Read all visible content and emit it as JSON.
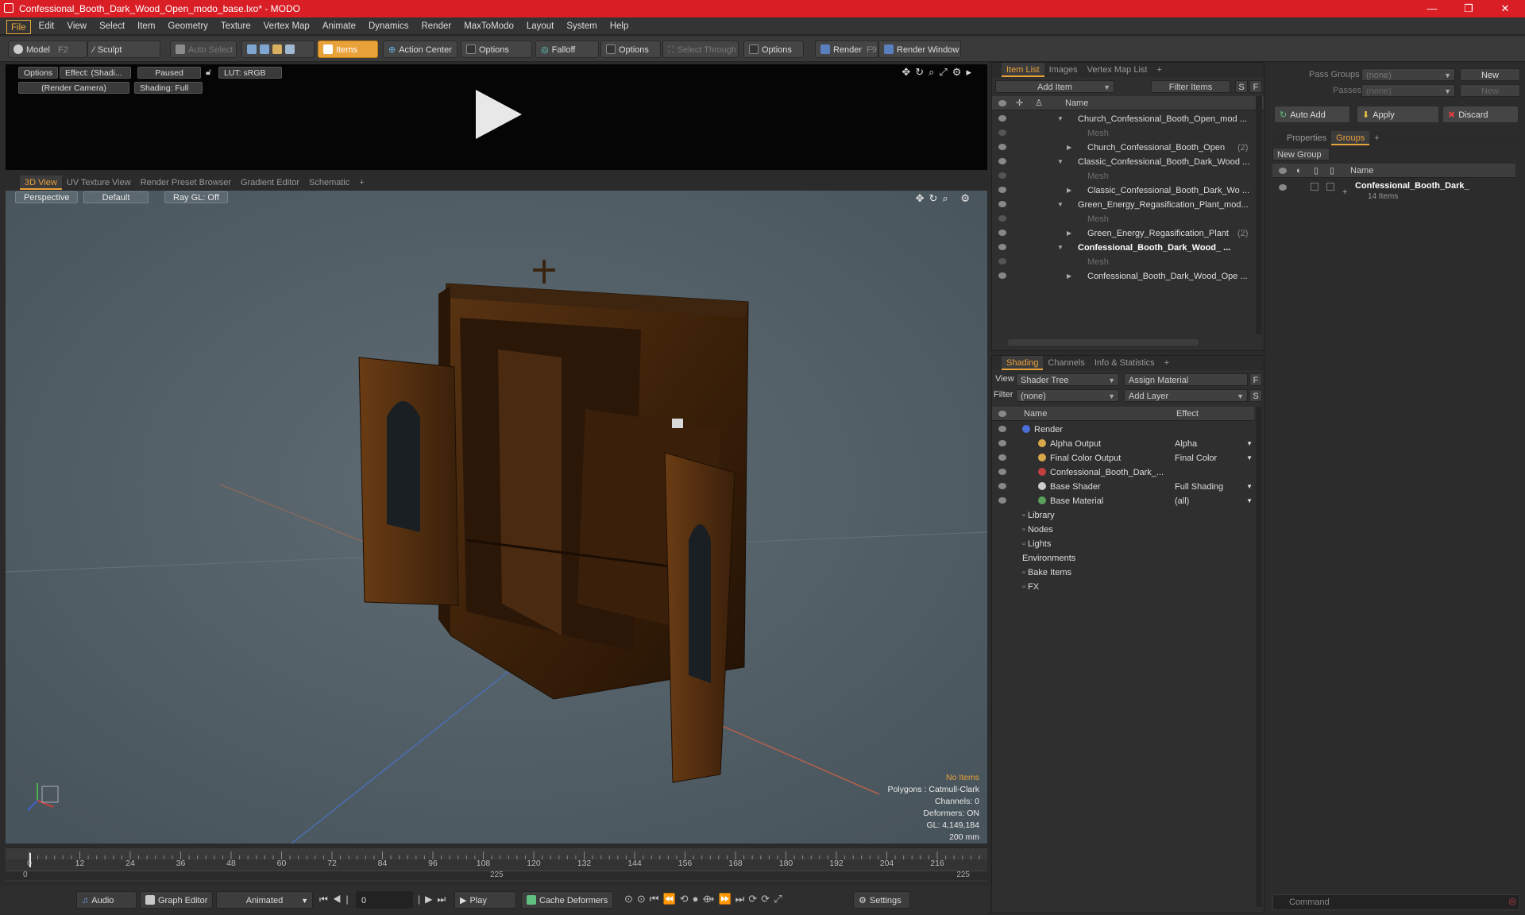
{
  "window": {
    "title": "Confessional_Booth_Dark_Wood_Open_modo_base.lxo* - MODO",
    "minimize": "—",
    "maximize": "❐",
    "close": "✕"
  },
  "menu": [
    "File",
    "Edit",
    "View",
    "Select",
    "Item",
    "Geometry",
    "Texture",
    "Vertex Map",
    "Animate",
    "Dynamics",
    "Render",
    "MaxToModo",
    "Layout",
    "System",
    "Help"
  ],
  "toolbar": {
    "model": "Model",
    "model_key": "F2",
    "sculpt": "Sculpt",
    "auto_select": "Auto Select",
    "items": "Items",
    "action_center": "Action Center",
    "options1": "Options",
    "falloff": "Falloff",
    "options2": "Options",
    "select_through": "Select Through",
    "options3": "Options",
    "render": "Render",
    "render_key": "F9",
    "render_window": "Render Window"
  },
  "preview": {
    "options": "Options",
    "effect": "Effect: (Shadi...",
    "paused": "Paused",
    "lut": "LUT: sRGB",
    "camera": "(Render Camera)",
    "shading": "Shading: Full"
  },
  "viewport_tabs": [
    "3D View",
    "UV Texture View",
    "Render Preset Browser",
    "Gradient Editor",
    "Schematic"
  ],
  "viewport": {
    "perspective": "Perspective",
    "default": "Default",
    "raygl": "Ray GL: Off",
    "stats": [
      "No Items",
      "Polygons : Catmull-Clark",
      "Channels: 0",
      "Deformers: ON",
      "GL: 4,149,184",
      "200 mm"
    ]
  },
  "timeline": {
    "ticks": [
      "0",
      "12",
      "24",
      "36",
      "48",
      "60",
      "72",
      "84",
      "96",
      "108",
      "120",
      "132",
      "144",
      "156",
      "168",
      "180",
      "192",
      "204",
      "216"
    ],
    "start": "0",
    "mid": "225",
    "end": "225"
  },
  "bottom": {
    "audio": "Audio",
    "graph_editor": "Graph Editor",
    "animated": "Animated",
    "frame": "0",
    "play": "Play",
    "cache_deformers": "Cache Deformers",
    "settings": "Settings"
  },
  "itemlist": {
    "tabs": [
      "Item List",
      "Images",
      "Vertex Map List"
    ],
    "add_item": "Add Item",
    "filter_items": "Filter Items",
    "s": "S",
    "f": "F",
    "col_name": "Name",
    "rows": [
      {
        "text": "Church_Confessional_Booth_Open_mod ...",
        "cls": "",
        "indent": 0
      },
      {
        "text": "Mesh",
        "cls": "mesh",
        "indent": 1
      },
      {
        "text": "Church_Confessional_Booth_Open",
        "count": "(2)",
        "cls": "",
        "indent": 1
      },
      {
        "text": "Classic_Confessional_Booth_Dark_Wood ...",
        "cls": "",
        "indent": 0
      },
      {
        "text": "Mesh",
        "cls": "mesh",
        "indent": 1
      },
      {
        "text": "Classic_Confessional_Booth_Dark_Wo ...",
        "cls": "",
        "indent": 1
      },
      {
        "text": "Green_Energy_Regasification_Plant_mod...",
        "cls": "",
        "indent": 0
      },
      {
        "text": "Mesh",
        "cls": "mesh",
        "indent": 1
      },
      {
        "text": "Green_Energy_Regasification_Plant",
        "count": "(2)",
        "cls": "",
        "indent": 1
      },
      {
        "text": "Confessional_Booth_Dark_Wood_ ...",
        "cls": "bold",
        "indent": 0
      },
      {
        "text": "Mesh",
        "cls": "mesh",
        "indent": 1
      },
      {
        "text": "Confessional_Booth_Dark_Wood_Ope ...",
        "cls": "",
        "indent": 1
      }
    ]
  },
  "shading": {
    "tabs": [
      "Shading",
      "Channels",
      "Info & Statistics"
    ],
    "view_label": "View",
    "view_value": "Shader Tree",
    "assign_material": "Assign Material",
    "filter_label": "Filter",
    "filter_value": "(none)",
    "add_layer": "Add Layer",
    "f": "F",
    "s": "S",
    "col_name": "Name",
    "col_effect": "Effect",
    "rows": [
      {
        "name": "Render",
        "effect": "",
        "color": "#4a6fd8",
        "indent": 0
      },
      {
        "name": "Alpha Output",
        "effect": "Alpha",
        "color": "#d9a84a",
        "indent": 1
      },
      {
        "name": "Final Color Output",
        "effect": "Final Color",
        "color": "#d9a84a",
        "indent": 1
      },
      {
        "name": "Confessional_Booth_Dark_...",
        "effect": "",
        "color": "#c04040",
        "indent": 1
      },
      {
        "name": "Base Shader",
        "effect": "Full Shading",
        "color": "#cccccc",
        "indent": 1
      },
      {
        "name": "Base Material",
        "effect": "(all)",
        "color": "#5aa05a",
        "indent": 1
      },
      {
        "name": "Library",
        "effect": "",
        "color": "",
        "indent": 0
      },
      {
        "name": "Nodes",
        "effect": "",
        "color": "",
        "indent": 0
      },
      {
        "name": "Lights",
        "effect": "",
        "color": "",
        "indent": 0
      },
      {
        "name": "Environments",
        "effect": "",
        "color": "",
        "indent": 0
      },
      {
        "name": "Bake Items",
        "effect": "",
        "color": "",
        "indent": 0
      },
      {
        "name": "FX",
        "effect": "",
        "color": "",
        "indent": 0
      }
    ]
  },
  "groups": {
    "pass_groups": "Pass Groups",
    "passes": "Passes",
    "none": "(none)",
    "new": "New",
    "auto_add": "Auto Add",
    "apply": "Apply",
    "discard": "Discard",
    "tabs": [
      "Properties",
      "Groups"
    ],
    "new_group": "New Group",
    "col_name": "Name",
    "group_name": "Confessional_Booth_Dark_",
    "group_count": "14 Items",
    "command": "Command"
  },
  "colors": {
    "accent": "#e9a13a",
    "titlebar": "#d91e25"
  }
}
